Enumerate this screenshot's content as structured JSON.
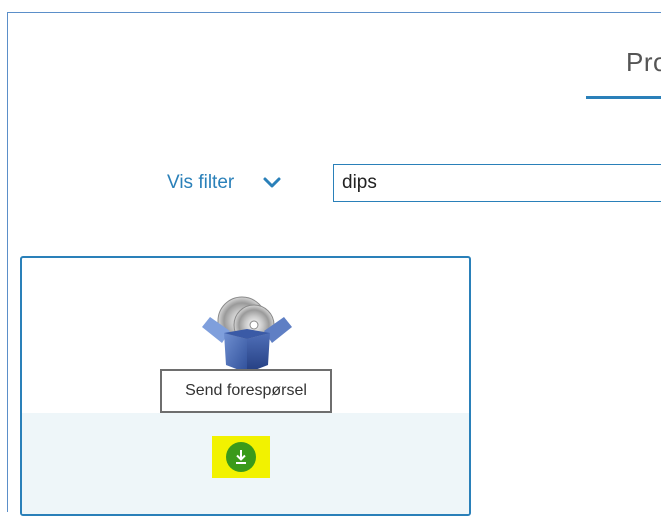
{
  "header": {
    "tab_title": "Pro"
  },
  "filter": {
    "toggle_label": "Vis filter",
    "toggle_icon": "chevron-down-icon",
    "search_value": "dips"
  },
  "card": {
    "icon": "software-package-icon",
    "tooltip": "Send forespørsel",
    "action_icon": "download-icon"
  },
  "colors": {
    "accent": "#2a80b9",
    "frame_border": "#5b8fc9",
    "highlight": "#f2f200",
    "download_green": "#3a9a1a",
    "card_footer_bg": "#eef6f9"
  }
}
